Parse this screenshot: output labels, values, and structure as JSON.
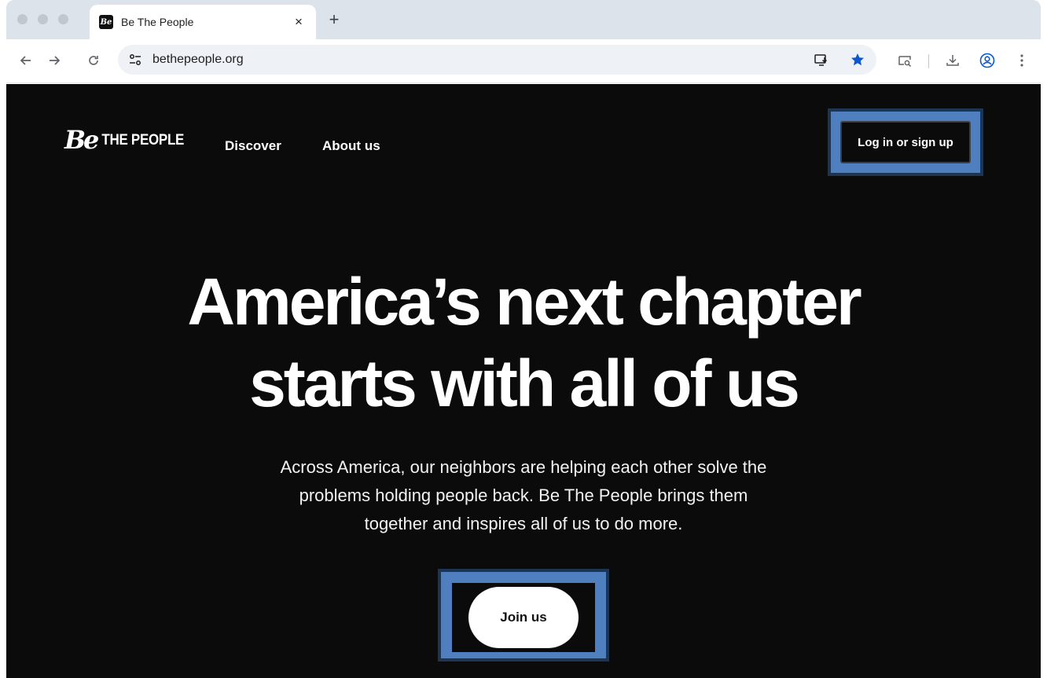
{
  "browser": {
    "tab": {
      "favicon_text": "Be",
      "title": "Be The People",
      "close_glyph": "×"
    },
    "new_tab_glyph": "+",
    "url": "bethepeople.org"
  },
  "site": {
    "logo": {
      "mark": "Be",
      "wordmark": "THE PEOPLE"
    },
    "nav": {
      "discover": "Discover",
      "about": "About us"
    },
    "login_label": "Log in or sign up",
    "hero": {
      "title_line1": "America’s next chapter",
      "title_line2": "starts with all of us",
      "subtitle_line1": "Across America, our neighbors are helping each other solve the",
      "subtitle_line2": "problems holding people back. Be The People brings them",
      "subtitle_line3": "together and inspires all of us to do more."
    },
    "join_label": "Join us"
  },
  "colors": {
    "page_background": "#0b0b0b",
    "highlight": "#4f7fbf",
    "bookmark_star": "#0b57d0"
  }
}
